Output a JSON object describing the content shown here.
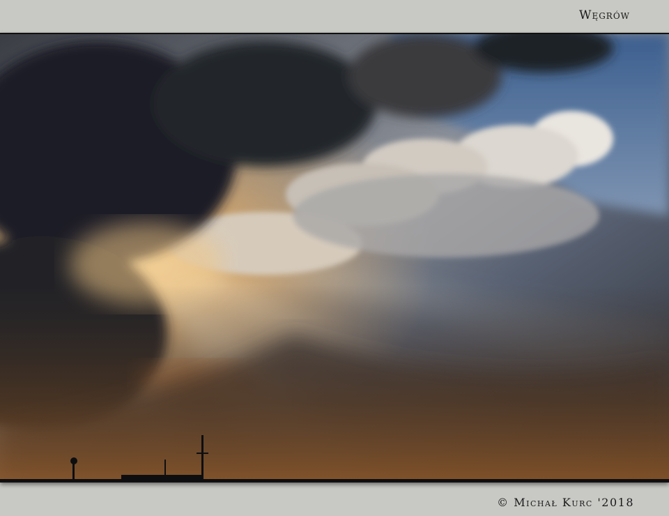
{
  "frame": {
    "title": "Węgrów",
    "credit": "© Michał Kurc '2018",
    "background_color": "#c8c9c4"
  },
  "photo": {
    "subject": "sunset-sky-with-crepuscular-rays",
    "palette": {
      "sky_blue": "#4f6e96",
      "storm_dark": "#1f2228",
      "sun_glow": "#f2c887",
      "cloud_highlight": "#ece8e2"
    }
  }
}
